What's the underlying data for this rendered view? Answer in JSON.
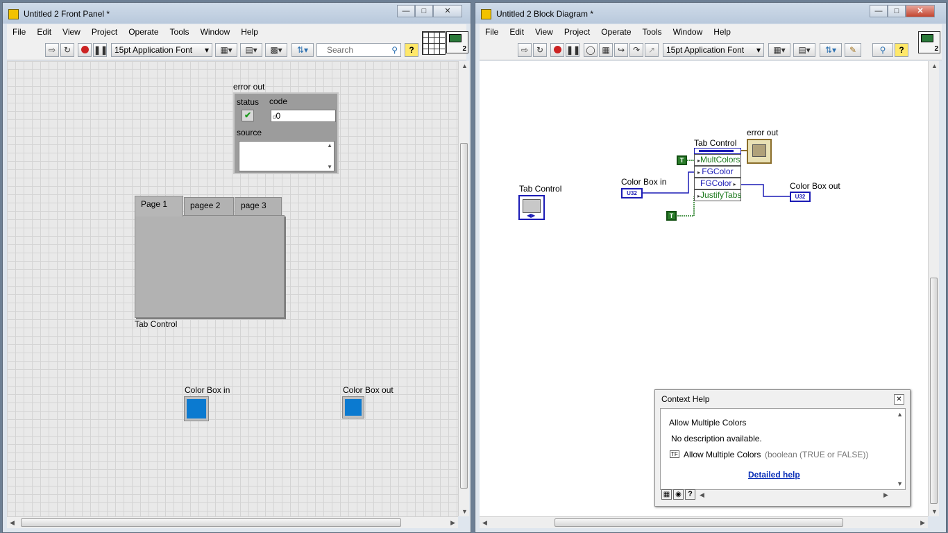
{
  "front_panel": {
    "title": "Untitled 2 Front Panel *",
    "menu": [
      "File",
      "Edit",
      "View",
      "Project",
      "Operate",
      "Tools",
      "Window",
      "Help"
    ],
    "font_select": "15pt Application Font",
    "search_placeholder": "Search",
    "connector_badge": "2",
    "error_out": {
      "label": "error out",
      "status_label": "status",
      "code_label": "code",
      "code_value": "0",
      "code_prefix": "d",
      "source_label": "source"
    },
    "tab_control": {
      "label": "Tab Control",
      "tabs": [
        "Page 1",
        "pagee 2",
        "page 3"
      ],
      "active_index": 0
    },
    "color_box_in": {
      "label": "Color Box in",
      "color": "#0b7ad0"
    },
    "color_box_out": {
      "label": "Color Box out",
      "color": "#0b7ad0"
    }
  },
  "block_diagram": {
    "title": "Untitled 2 Block Diagram *",
    "menu": [
      "File",
      "Edit",
      "View",
      "Project",
      "Operate",
      "Tools",
      "Window",
      "Help"
    ],
    "font_select": "15pt Application Font",
    "connector_badge": "2",
    "nodes": {
      "tab_control_terminal": "Tab Control",
      "color_box_in": "Color Box in",
      "color_box_in_type": "U32",
      "color_box_out": "Color Box out",
      "color_box_out_type": "U32",
      "error_out": "error out",
      "property_node_title": "Tab Control",
      "property_rows": [
        "MultColors",
        "FGColor",
        "FGColor",
        "JustifyTabs"
      ],
      "bool_constant": "T"
    },
    "context_help": {
      "title": "Context Help",
      "heading": "Allow Multiple Colors",
      "description": "No description available.",
      "term_name": "Allow Multiple Colors",
      "term_type": "(boolean (TRUE or FALSE))",
      "link": "Detailed help",
      "type_badge": "TF"
    }
  }
}
